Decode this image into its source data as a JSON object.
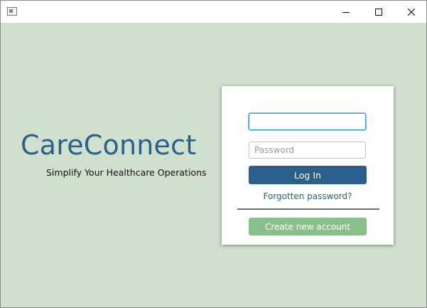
{
  "window": {
    "title": "",
    "icons": {
      "app": "app-window-icon",
      "minimize": "minimize-icon",
      "maximize": "maximize-icon",
      "close": "close-icon"
    }
  },
  "hero": {
    "brand": "CareConnect",
    "tagline": "Simplify Your Healthcare Operations"
  },
  "login": {
    "username_value": "",
    "username_placeholder": "",
    "password_value": "",
    "password_placeholder": "Password",
    "login_label": "Log In",
    "forgot_label": "Forgotten password?",
    "create_label": "Create new account"
  },
  "colors": {
    "background": "#cfe1cd",
    "brand": "#2c5f8c",
    "primary_button": "#2b5f8b",
    "secondary_button": "#88c08a",
    "focus_ring": "#3b9ad9"
  }
}
